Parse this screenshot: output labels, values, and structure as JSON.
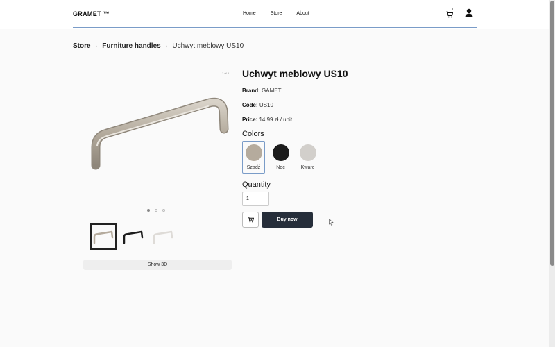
{
  "header": {
    "logo": "GRAMET ™",
    "nav": [
      "Home",
      "Store",
      "About"
    ],
    "cart_count": "0",
    "cart_icon": "cart-icon",
    "user_icon": "user-icon"
  },
  "breadcrumb": {
    "items": [
      "Store",
      "Furniture handles"
    ],
    "current": "Uchwyt meblowy US10",
    "separator": "›"
  },
  "gallery": {
    "image_count": "1 of 3",
    "image_alt": "Satin nickel furniture handle",
    "dots_total": 3,
    "dots_active": 0,
    "thumbnail_colors": [
      "#bdb5a8",
      "#1a1a1a",
      "#e6e4e1"
    ],
    "selected_thumbnail": 0,
    "show_3d_label": "Show 3D"
  },
  "product": {
    "title": "Uchwyt meblowy US10",
    "brand_label": "Brand:",
    "brand": "GAMET",
    "code_label": "Code:",
    "code": "US10",
    "price_label": "Price:",
    "price": "14.99 zł / unit",
    "colors_heading": "Colors",
    "colors": [
      {
        "name": "Szadź",
        "hex": "#b5ab9d",
        "selected": true
      },
      {
        "name": "Noc",
        "hex": "#1c1c1c",
        "selected": false
      },
      {
        "name": "Kwarc",
        "hex": "#d2cfcb",
        "selected": false
      }
    ],
    "quantity_heading": "Quantity",
    "quantity_value": "1",
    "buy_label": "Buy now",
    "add_to_cart_icon": "cart-plus-icon"
  },
  "colors": {
    "accent_rule": "#7a9cc8",
    "buy_button": "#262e3a"
  }
}
